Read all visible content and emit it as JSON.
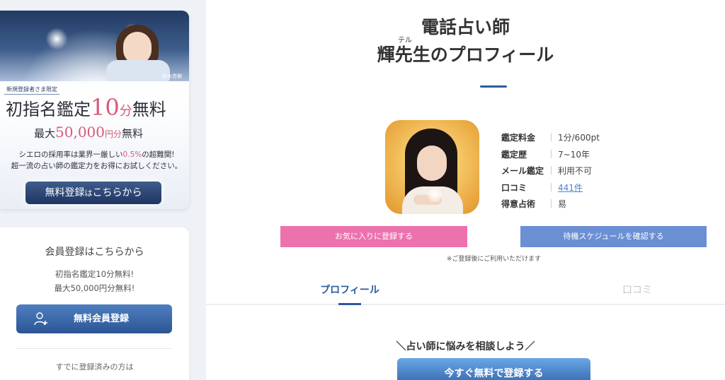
{
  "banner": {
    "caption": "鈴木杏樹",
    "limited": "新規登録者さま限定",
    "headline_a": "初指名鑑定",
    "headline_num": "10",
    "headline_unit": "分",
    "headline_b": "無料",
    "sub_a": "最大",
    "sub_num": "50,000",
    "sub_unit": "円分",
    "sub_b": "無料",
    "desc_a": "シエロの採用率は業界一厳しい",
    "desc_pct": "0.5%",
    "desc_b": "の超難関!",
    "desc_line2": "超一流の占い師の鑑定力をお得にお試しください。",
    "button_main": "無料登録",
    "button_small": "は",
    "button_tail": "こちらから"
  },
  "member": {
    "title": "会員登録はこちらから",
    "desc_line1": "初指名鑑定10分無料!",
    "desc_line2": "最大50,000円分無料!",
    "button_label": "無料会員登録",
    "already": "すでに登録済みの方は"
  },
  "profile": {
    "title_line1": "電話占い師",
    "ruby": "テル",
    "title_line2": "輝先生のプロフィール",
    "info": [
      {
        "key": "鑑定料金",
        "value": "1分/600pt"
      },
      {
        "key": "鑑定歴",
        "value": "7~10年"
      },
      {
        "key": "メール鑑定",
        "value": "利用不可"
      },
      {
        "key": "口コミ",
        "value": "441件"
      },
      {
        "key": "得意占術",
        "value": "易"
      }
    ],
    "fav_button": "お気に入りに登録する",
    "schedule_button": "待機スケジュールを確認する",
    "note": "※ご登録後にご利用いただけます"
  },
  "tabs": {
    "profile": "プロフィール",
    "reviews": "口コミ"
  },
  "cta": {
    "consult": "＼占い師に悩みを相談しよう／",
    "register": "今すぐ無料で登録する"
  },
  "colors": {
    "accent_blue": "#2c5aa0",
    "pink": "#ec72ad",
    "schedule_blue": "#6b8fd3",
    "highlight_pink": "#d85a7a"
  }
}
